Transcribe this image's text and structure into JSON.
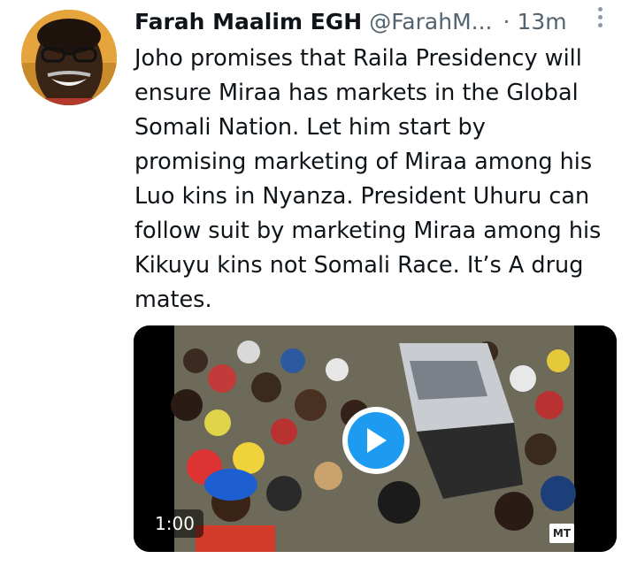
{
  "tweet": {
    "display_name": "Farah Maalim EGH",
    "handle": "@FarahM...",
    "separator": "·",
    "time": "13m",
    "more_icon": "more-vertical-icon",
    "text": "Joho promises that Raila Presidency will\nensure Miraa has markets in the Global\nSomali Nation. Let him start by\npromising marketing of Miraa among his\nLuo kins in Nyanza. President Uhuru can\nfollow suit by marketing Miraa among his\nKikuyu kins not Somali Race. It’s A drug\nmates.",
    "media": {
      "type": "video",
      "duration": "1:00",
      "play_icon": "play-icon",
      "watermark": "MT"
    }
  },
  "colors": {
    "text_primary": "#0f1419",
    "text_secondary": "#536471",
    "accent": "#1d9bf0",
    "background": "#ffffff"
  }
}
